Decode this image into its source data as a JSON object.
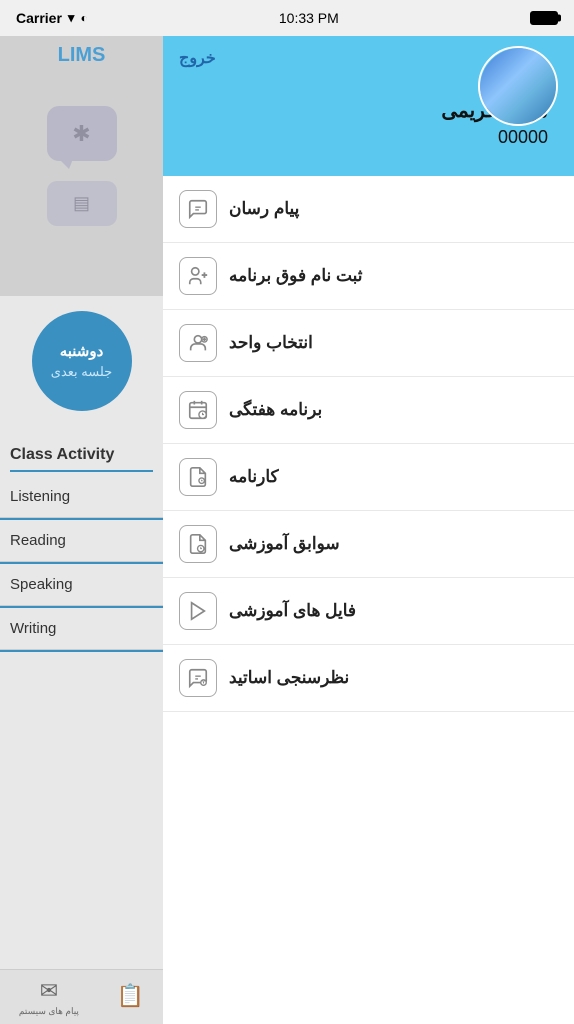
{
  "statusBar": {
    "carrier": "Carrier",
    "time": "10:33 PM",
    "batteryFull": true
  },
  "sidebar": {
    "appName": "LIMS",
    "circle": {
      "topText": "دوشنبه",
      "bottomText": "جلسه بعدی"
    },
    "classActivityTitle": "Class Activity",
    "items": [
      {
        "label": "Listening"
      },
      {
        "label": "Reading"
      },
      {
        "label": "Speaking"
      },
      {
        "label": "Writing"
      }
    ],
    "bottomTabs": [
      {
        "icon": "✉",
        "label": "پیام های سیستم"
      },
      {
        "icon": "📋",
        "label": ""
      }
    ]
  },
  "profile": {
    "logoutLabel": "خروج",
    "name": "مهدیه کریمی",
    "userId": "00000"
  },
  "menuItems": [
    {
      "text": "پیام رسان",
      "iconType": "chat"
    },
    {
      "text": "ثبت نام فوق برنامه",
      "iconType": "group-add"
    },
    {
      "text": "انتخاب واحد",
      "iconType": "person-add"
    },
    {
      "text": "برنامه هفتگی",
      "iconType": "calendar-clock"
    },
    {
      "text": "کارنامه",
      "iconType": "document-clock"
    },
    {
      "text": "سوابق آموزشی",
      "iconType": "history"
    },
    {
      "text": "فایل های آموزشی",
      "iconType": "play"
    },
    {
      "text": "نظرسنجی اساتید",
      "iconType": "survey"
    }
  ]
}
